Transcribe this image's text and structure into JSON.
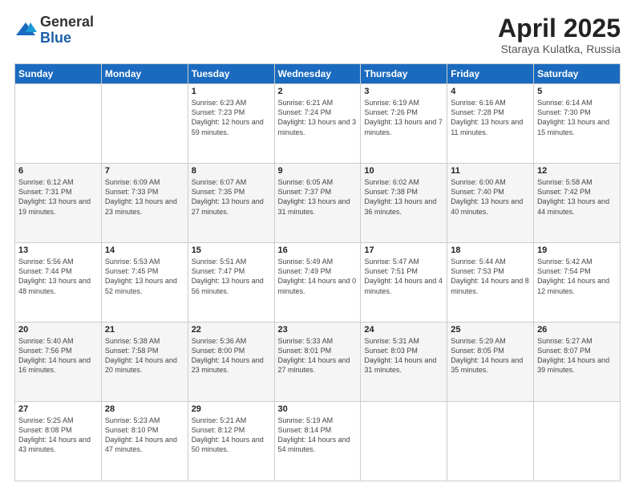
{
  "logo": {
    "general": "General",
    "blue": "Blue"
  },
  "title": {
    "month": "April 2025",
    "location": "Staraya Kulatka, Russia"
  },
  "headers": [
    "Sunday",
    "Monday",
    "Tuesday",
    "Wednesday",
    "Thursday",
    "Friday",
    "Saturday"
  ],
  "weeks": [
    [
      {
        "day": "",
        "info": ""
      },
      {
        "day": "",
        "info": ""
      },
      {
        "day": "1",
        "info": "Sunrise: 6:23 AM\nSunset: 7:23 PM\nDaylight: 12 hours and 59 minutes."
      },
      {
        "day": "2",
        "info": "Sunrise: 6:21 AM\nSunset: 7:24 PM\nDaylight: 13 hours and 3 minutes."
      },
      {
        "day": "3",
        "info": "Sunrise: 6:19 AM\nSunset: 7:26 PM\nDaylight: 13 hours and 7 minutes."
      },
      {
        "day": "4",
        "info": "Sunrise: 6:16 AM\nSunset: 7:28 PM\nDaylight: 13 hours and 11 minutes."
      },
      {
        "day": "5",
        "info": "Sunrise: 6:14 AM\nSunset: 7:30 PM\nDaylight: 13 hours and 15 minutes."
      }
    ],
    [
      {
        "day": "6",
        "info": "Sunrise: 6:12 AM\nSunset: 7:31 PM\nDaylight: 13 hours and 19 minutes."
      },
      {
        "day": "7",
        "info": "Sunrise: 6:09 AM\nSunset: 7:33 PM\nDaylight: 13 hours and 23 minutes."
      },
      {
        "day": "8",
        "info": "Sunrise: 6:07 AM\nSunset: 7:35 PM\nDaylight: 13 hours and 27 minutes."
      },
      {
        "day": "9",
        "info": "Sunrise: 6:05 AM\nSunset: 7:37 PM\nDaylight: 13 hours and 31 minutes."
      },
      {
        "day": "10",
        "info": "Sunrise: 6:02 AM\nSunset: 7:38 PM\nDaylight: 13 hours and 36 minutes."
      },
      {
        "day": "11",
        "info": "Sunrise: 6:00 AM\nSunset: 7:40 PM\nDaylight: 13 hours and 40 minutes."
      },
      {
        "day": "12",
        "info": "Sunrise: 5:58 AM\nSunset: 7:42 PM\nDaylight: 13 hours and 44 minutes."
      }
    ],
    [
      {
        "day": "13",
        "info": "Sunrise: 5:56 AM\nSunset: 7:44 PM\nDaylight: 13 hours and 48 minutes."
      },
      {
        "day": "14",
        "info": "Sunrise: 5:53 AM\nSunset: 7:45 PM\nDaylight: 13 hours and 52 minutes."
      },
      {
        "day": "15",
        "info": "Sunrise: 5:51 AM\nSunset: 7:47 PM\nDaylight: 13 hours and 56 minutes."
      },
      {
        "day": "16",
        "info": "Sunrise: 5:49 AM\nSunset: 7:49 PM\nDaylight: 14 hours and 0 minutes."
      },
      {
        "day": "17",
        "info": "Sunrise: 5:47 AM\nSunset: 7:51 PM\nDaylight: 14 hours and 4 minutes."
      },
      {
        "day": "18",
        "info": "Sunrise: 5:44 AM\nSunset: 7:53 PM\nDaylight: 14 hours and 8 minutes."
      },
      {
        "day": "19",
        "info": "Sunrise: 5:42 AM\nSunset: 7:54 PM\nDaylight: 14 hours and 12 minutes."
      }
    ],
    [
      {
        "day": "20",
        "info": "Sunrise: 5:40 AM\nSunset: 7:56 PM\nDaylight: 14 hours and 16 minutes."
      },
      {
        "day": "21",
        "info": "Sunrise: 5:38 AM\nSunset: 7:58 PM\nDaylight: 14 hours and 20 minutes."
      },
      {
        "day": "22",
        "info": "Sunrise: 5:36 AM\nSunset: 8:00 PM\nDaylight: 14 hours and 23 minutes."
      },
      {
        "day": "23",
        "info": "Sunrise: 5:33 AM\nSunset: 8:01 PM\nDaylight: 14 hours and 27 minutes."
      },
      {
        "day": "24",
        "info": "Sunrise: 5:31 AM\nSunset: 8:03 PM\nDaylight: 14 hours and 31 minutes."
      },
      {
        "day": "25",
        "info": "Sunrise: 5:29 AM\nSunset: 8:05 PM\nDaylight: 14 hours and 35 minutes."
      },
      {
        "day": "26",
        "info": "Sunrise: 5:27 AM\nSunset: 8:07 PM\nDaylight: 14 hours and 39 minutes."
      }
    ],
    [
      {
        "day": "27",
        "info": "Sunrise: 5:25 AM\nSunset: 8:08 PM\nDaylight: 14 hours and 43 minutes."
      },
      {
        "day": "28",
        "info": "Sunrise: 5:23 AM\nSunset: 8:10 PM\nDaylight: 14 hours and 47 minutes."
      },
      {
        "day": "29",
        "info": "Sunrise: 5:21 AM\nSunset: 8:12 PM\nDaylight: 14 hours and 50 minutes."
      },
      {
        "day": "30",
        "info": "Sunrise: 5:19 AM\nSunset: 8:14 PM\nDaylight: 14 hours and 54 minutes."
      },
      {
        "day": "",
        "info": ""
      },
      {
        "day": "",
        "info": ""
      },
      {
        "day": "",
        "info": ""
      }
    ]
  ]
}
